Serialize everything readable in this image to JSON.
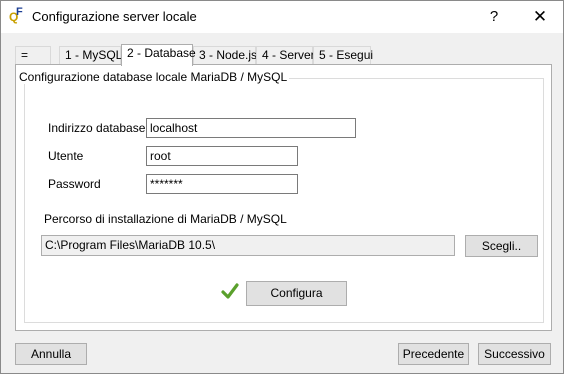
{
  "window": {
    "title": "Configurazione server locale",
    "help_glyph": "?",
    "close_glyph": "✕"
  },
  "tabs": [
    {
      "label": "=",
      "active": false
    },
    {
      "label": "1 - MySQL",
      "active": false
    },
    {
      "label": "2 - Database",
      "active": true
    },
    {
      "label": "3 - Node.js",
      "active": false
    },
    {
      "label": "4 - Server",
      "active": false
    },
    {
      "label": "5 - Esegui",
      "active": false
    }
  ],
  "group": {
    "title": "Configurazione database locale MariaDB / MySQL"
  },
  "form": {
    "address_label": "Indirizzo database:",
    "address_value": "localhost",
    "user_label": "Utente",
    "user_value": "root",
    "password_label": "Password",
    "password_value": "*******",
    "path_label": "Percorso di installazione di MariaDB / MySQL",
    "path_value": "C:\\Program Files\\MariaDB 10.5\\",
    "browse_label": "Scegli..",
    "configure_label": "Configura"
  },
  "footer": {
    "cancel_label": "Annulla",
    "prev_label": "Precedente",
    "next_label": "Successivo"
  },
  "colors": {
    "check": "#5aa02c",
    "window_bg": "#f0f0f0"
  },
  "icons": {
    "app": "qf-app-icon",
    "status": "check-icon"
  }
}
